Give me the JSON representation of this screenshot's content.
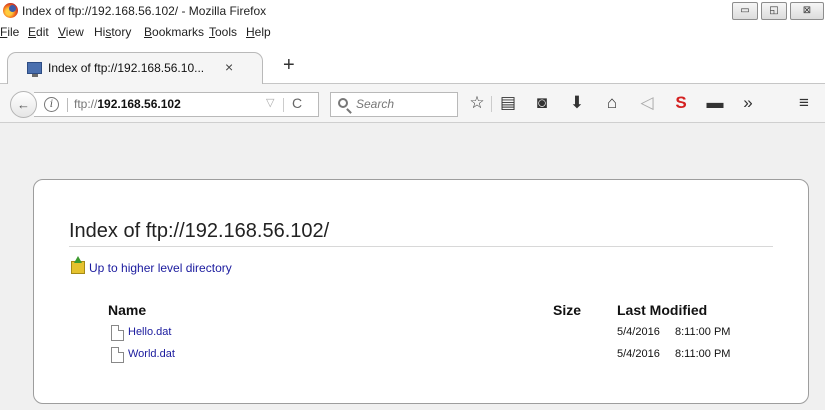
{
  "window": {
    "title": "Index of ftp://192.168.56.102/ - Mozilla Firefox",
    "controls": {
      "minimize": "▭",
      "maximize": "◱",
      "close": "⊠"
    }
  },
  "menubar": {
    "items": [
      "File",
      "Edit",
      "View",
      "History",
      "Bookmarks",
      "Tools",
      "Help"
    ]
  },
  "tab": {
    "title": "Index of ftp://192.168.56.10...",
    "close": "×",
    "new_tab": "+"
  },
  "navbar": {
    "back": "←",
    "info": "i",
    "url_prefix": "ftp://",
    "url_host": "192.168.56.102",
    "dropdown": "▽",
    "reload": "C",
    "search_placeholder": "Search",
    "toolbar_icons": [
      {
        "icon": "bookmark-star-icon",
        "glyph": "☆"
      },
      {
        "icon": "reading-list-icon",
        "glyph": "▤"
      },
      {
        "icon": "pocket-icon",
        "glyph": "◙"
      },
      {
        "icon": "download-icon",
        "glyph": "⬇"
      },
      {
        "icon": "home-icon",
        "glyph": "⌂"
      },
      {
        "icon": "send-icon",
        "glyph": "◁"
      },
      {
        "icon": "shield-extension-icon",
        "glyph": "S"
      },
      {
        "icon": "folder-icon",
        "glyph": "▬"
      },
      {
        "icon": "overflow-icon",
        "glyph": "»"
      },
      {
        "icon": "hamburger-menu-icon",
        "glyph": "≡"
      }
    ]
  },
  "page": {
    "heading": "Index of ftp://192.168.56.102/",
    "up_link": "Up to higher level directory",
    "columns": {
      "name": "Name",
      "size": "Size",
      "modified": "Last Modified"
    },
    "files": [
      {
        "name": "Hello.dat",
        "size": "",
        "date": "5/4/2016",
        "time": "8:11:00 PM"
      },
      {
        "name": "World.dat",
        "size": "",
        "date": "5/4/2016",
        "time": "8:11:00 PM"
      }
    ]
  }
}
